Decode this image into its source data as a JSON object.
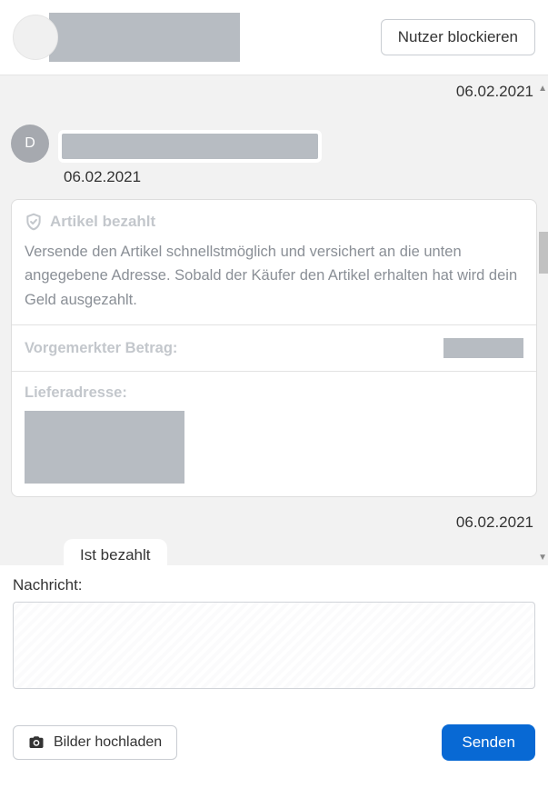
{
  "header": {
    "block_label": "Nutzer blockieren"
  },
  "chat": {
    "date_sep_1": "06.02.2021",
    "msg1": {
      "avatar_initial": "D",
      "date": "06.02.2021"
    },
    "payment_card": {
      "title": "Artikel bezahlt",
      "body": "Versende den Artikel schnellstmöglich und versichert an die unten angegebene Adresse. Sobald der Käufer den Artikel erhalten hat wird dein Geld ausgezahlt.",
      "amount_label": "Vorgemerkter Betrag:",
      "address_label": "Lieferadresse:"
    },
    "date_sep_2": "06.02.2021",
    "msg2_text": "Ist bezahlt"
  },
  "compose": {
    "label": "Nachricht:",
    "upload_label": "Bilder hochladen",
    "send_label": "Senden"
  }
}
